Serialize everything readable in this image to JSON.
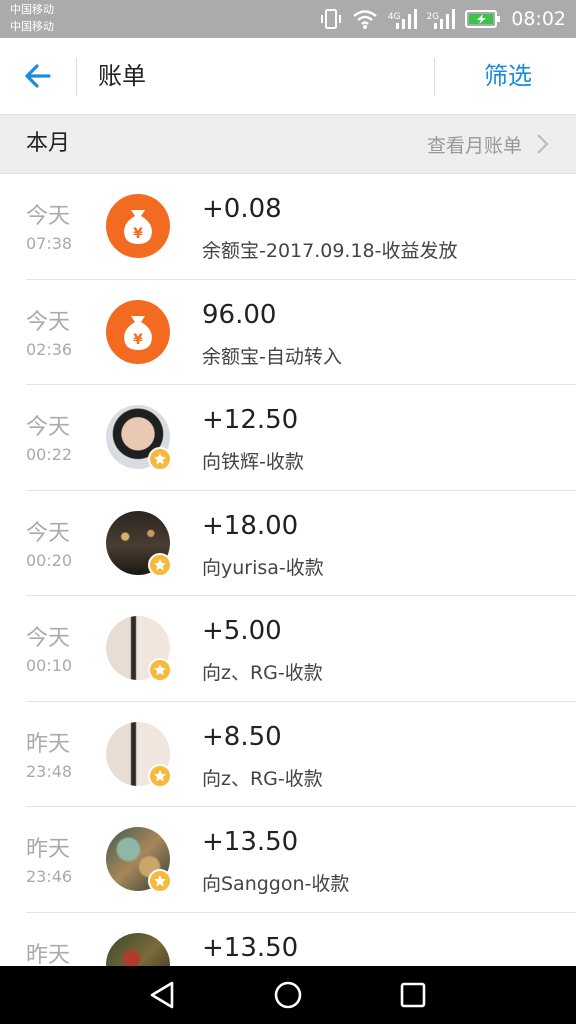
{
  "status_bar": {
    "carrier1": "中国移动",
    "carrier2": "中国移动",
    "net1": "4G",
    "net2": "2G",
    "time": "08:02"
  },
  "nav": {
    "title": "账单",
    "filter_label": "筛选"
  },
  "section": {
    "title": "本月",
    "monthly_link": "查看月账单"
  },
  "transactions": [
    {
      "day": "今天",
      "time": "07:38",
      "amount": "+0.08",
      "desc": "余额宝-2017.09.18-收益发放",
      "avatar": "yuebao-icon"
    },
    {
      "day": "今天",
      "time": "02:36",
      "amount": "96.00",
      "desc": "余额宝-自动转入",
      "avatar": "yuebao-icon"
    },
    {
      "day": "今天",
      "time": "00:22",
      "amount": "+12.50",
      "desc": "向铁辉-收款",
      "avatar": "user-photo"
    },
    {
      "day": "今天",
      "time": "00:20",
      "amount": "+18.00",
      "desc": "向yurisa-收款",
      "avatar": "user-photo"
    },
    {
      "day": "今天",
      "time": "00:10",
      "amount": "+5.00",
      "desc": "向z、RG-收款",
      "avatar": "user-photo"
    },
    {
      "day": "昨天",
      "time": "23:48",
      "amount": "+8.50",
      "desc": "向z、RG-收款",
      "avatar": "user-photo"
    },
    {
      "day": "昨天",
      "time": "23:46",
      "amount": "+13.50",
      "desc": "向Sanggon-收款",
      "avatar": "user-photo"
    },
    {
      "day": "昨天",
      "time": "",
      "amount": "+13.50",
      "desc": "",
      "avatar": "user-photo"
    }
  ],
  "colors": {
    "accent": "#1a8dde",
    "yuebao_orange": "#f26b21",
    "badge_gold": "#f6b93b"
  }
}
